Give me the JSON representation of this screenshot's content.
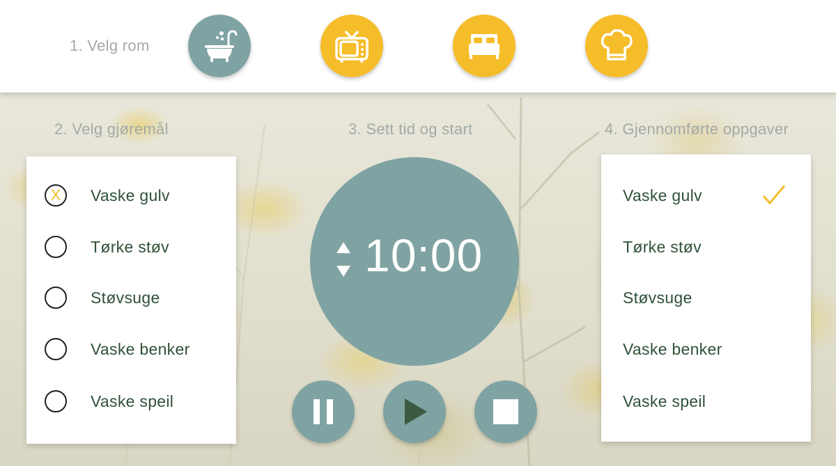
{
  "steps": {
    "choose_room": "1. Velg rom",
    "choose_task": "2. Velg gjøremål",
    "set_timer": "3. Sett tid og start",
    "completed": "4. Gjennomførte oppgaver"
  },
  "rooms": [
    {
      "icon": "bathtub-icon",
      "selected": true,
      "color": "#7fa3a2"
    },
    {
      "icon": "tv-icon",
      "selected": false,
      "color": "#f6bd2a"
    },
    {
      "icon": "bed-icon",
      "selected": false,
      "color": "#f6bd2a"
    },
    {
      "icon": "chef-hat-icon",
      "selected": false,
      "color": "#f6bd2a"
    }
  ],
  "tasks": [
    {
      "label": "Vaske gulv",
      "mark": "X"
    },
    {
      "label": "Tørke støv",
      "mark": ""
    },
    {
      "label": "Støvsuge",
      "mark": ""
    },
    {
      "label": "Vaske benker",
      "mark": ""
    },
    {
      "label": "Vaske speil",
      "mark": ""
    }
  ],
  "timer": {
    "value": "10:00",
    "controls": [
      "pause-icon",
      "play-icon",
      "stop-icon"
    ]
  },
  "completed_tasks": [
    {
      "label": "Vaske gulv",
      "done": true
    },
    {
      "label": "Tørke støv",
      "done": false
    },
    {
      "label": "Støvsuge",
      "done": false
    },
    {
      "label": "Vaske benker",
      "done": false
    },
    {
      "label": "Vaske speil",
      "done": false
    }
  ],
  "colors": {
    "accent_teal": "#7fa3a2",
    "accent_yellow": "#f6bd2a",
    "text_green": "#2f5138",
    "label_gray": "#a3aaa6",
    "play_dark": "#3c5a41"
  }
}
